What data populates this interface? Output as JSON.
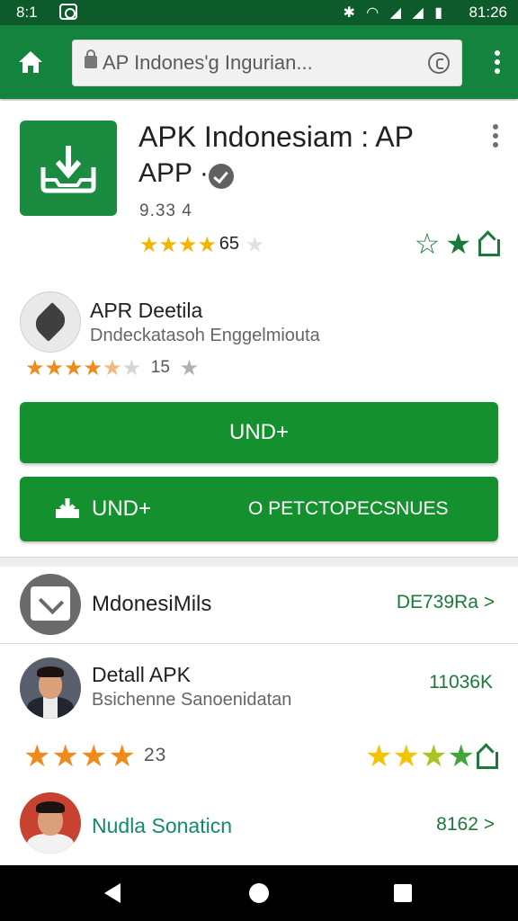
{
  "status_bar": {
    "time_left": "8:1",
    "time_right": "81:26",
    "indicators": "✱ ◠ ◢ ◢ ▮"
  },
  "toolbar": {
    "url_text": "AP Indones'g Ingurian...",
    "home_icon": "home-icon",
    "reload_icon": "reload-icon",
    "menu_icon": "more-vert-icon"
  },
  "app": {
    "title": "APK Indonesiam : AP",
    "subtitle": "APP ·",
    "version": "9.33 4",
    "rating_value": "65",
    "rating_stars": 4,
    "icon": "download-tray-icon",
    "actions": [
      "star-outline-icon",
      "star-filled-icon",
      "share-icon"
    ]
  },
  "developer": {
    "name": "APR Deetila",
    "description": "Dndeckatasoh Enggelmiouta",
    "rating_value": "15",
    "rating_stars": 4.5
  },
  "buttons": {
    "primary_label": "UND+",
    "split_left_label": "UND+",
    "split_right_label": "O PETCTOPECSNUES"
  },
  "list": {
    "row1": {
      "title": "MdonesiMils",
      "meta": "DE739Ra"
    },
    "row2": {
      "title": "Detall APK",
      "subtitle": "Bsichenne Sanoenidatan",
      "size": "11036K",
      "left_rating": "23"
    },
    "row3": {
      "title": "Nudla Sonaticn",
      "meta": "8162"
    }
  },
  "colors": {
    "app_bar": "#13833d",
    "status_bar": "#0d5b2b",
    "button": "#14902f",
    "accent_text": "#1b7a3a",
    "star_yellow": "#f5b400",
    "star_orange": "#f08a1b"
  }
}
